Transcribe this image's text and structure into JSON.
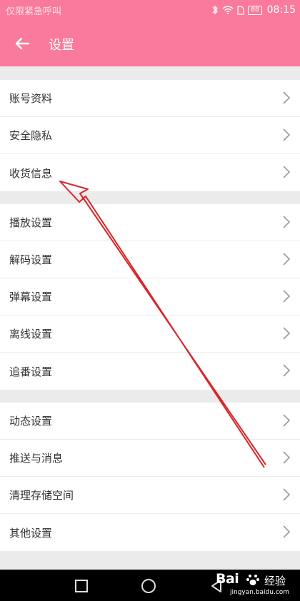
{
  "status_bar": {
    "carrier": "仅限紧急呼叫",
    "battery": "88",
    "time": "08:15"
  },
  "header": {
    "title": "设置"
  },
  "groups": [
    {
      "items": [
        {
          "label": "账号资料"
        },
        {
          "label": "安全隐私"
        },
        {
          "label": "收货信息"
        }
      ]
    },
    {
      "items": [
        {
          "label": "播放设置"
        },
        {
          "label": "解码设置"
        },
        {
          "label": "弹幕设置"
        },
        {
          "label": "离线设置"
        },
        {
          "label": "追番设置"
        }
      ]
    },
    {
      "items": [
        {
          "label": "动态设置"
        },
        {
          "label": "推送与消息"
        },
        {
          "label": "清理存储空间"
        },
        {
          "label": "其他设置"
        }
      ]
    }
  ],
  "watermark": {
    "brand": "Bai",
    "brand2": "经验",
    "url": "jingyan.baidu.com"
  },
  "colors": {
    "header": "#f97a9c",
    "annotation_arrow": "#d8252c"
  }
}
